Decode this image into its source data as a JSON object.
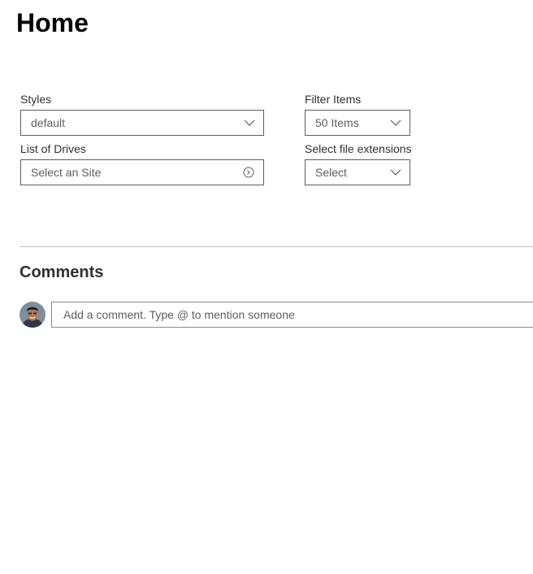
{
  "page": {
    "title": "Home"
  },
  "form": {
    "styles": {
      "label": "Styles",
      "value": "default",
      "icon": "chevron-down-icon"
    },
    "filter_items": {
      "label": "Filter Items",
      "value": "50 Items",
      "icon": "chevron-down-icon"
    },
    "list_of_drives": {
      "label": "List of Drives",
      "placeholder": "Select an Site",
      "icon": "circle-arrow-icon"
    },
    "file_extensions": {
      "label": "Select file extensions",
      "value": "Select",
      "icon": "chevron-down-icon"
    }
  },
  "comments": {
    "title": "Comments",
    "input_placeholder": "Add a comment. Type @ to mention someone"
  },
  "colors": {
    "border": "#605e5c",
    "divider": "#c8c6c4",
    "text": "#323130",
    "title": "#000000"
  }
}
